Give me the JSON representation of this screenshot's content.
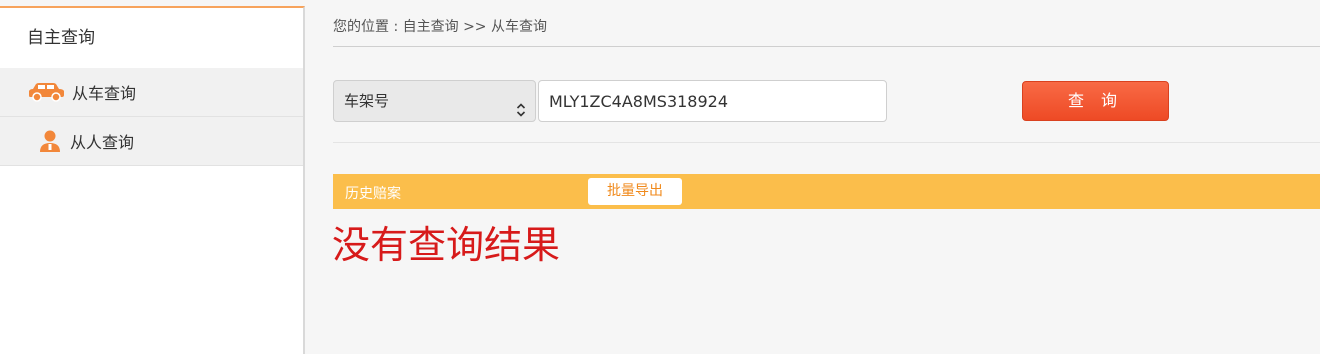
{
  "sidebar": {
    "title": "自主查询",
    "items": [
      {
        "label": "从车查询",
        "icon": "car-icon"
      },
      {
        "label": "从人查询",
        "icon": "person-icon"
      }
    ]
  },
  "breadcrumb": "您的位置 : 自主查询 >> 从车查询",
  "search": {
    "field_type": "车架号",
    "value": "MLY1ZC4A8MS318924",
    "button_label": "查 询"
  },
  "history": {
    "label": "历史赔案",
    "export_label": "批量导出"
  },
  "result_message": "没有查询结果",
  "colors": {
    "accent": "#ee4a25",
    "history_bar": "#fbbe4b",
    "icon_orange": "#f2873a",
    "no_result": "#d71a1a"
  }
}
